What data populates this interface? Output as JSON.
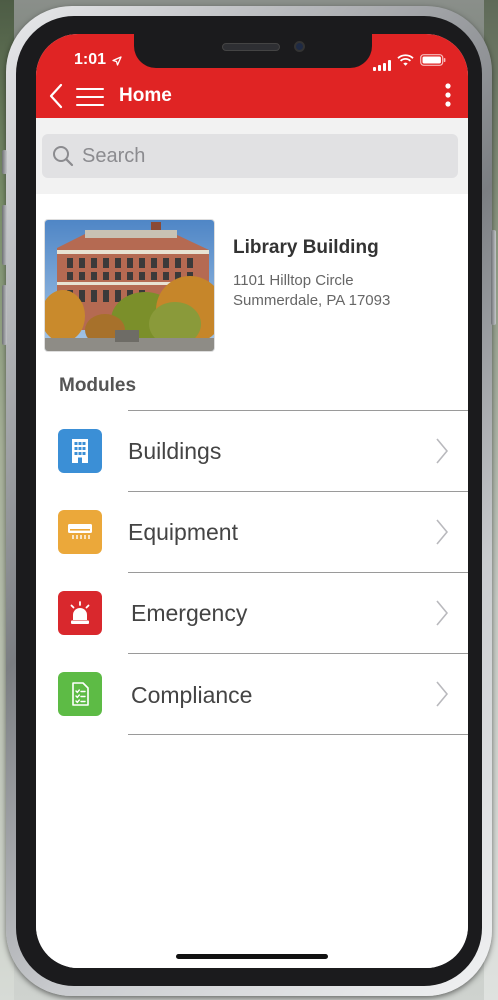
{
  "status_bar": {
    "time": "1:01"
  },
  "nav_bar": {
    "title": "Home"
  },
  "search": {
    "placeholder": "Search"
  },
  "building": {
    "name": "Library Building",
    "address_line1": "1101 Hilltop Circle",
    "address_line2": "Summerdale, PA 17093"
  },
  "modules": {
    "title": "Modules",
    "items": [
      {
        "label": "Buildings",
        "icon": "building-icon",
        "color": "#3b8fd6"
      },
      {
        "label": "Equipment",
        "icon": "air-conditioner-icon",
        "color": "#eba83a"
      },
      {
        "label": "Emergency",
        "icon": "siren-icon",
        "color": "#d9282d"
      },
      {
        "label": "Compliance",
        "icon": "checklist-icon",
        "color": "#5dbb45"
      }
    ]
  },
  "colors": {
    "brand_red": "#e02424"
  }
}
